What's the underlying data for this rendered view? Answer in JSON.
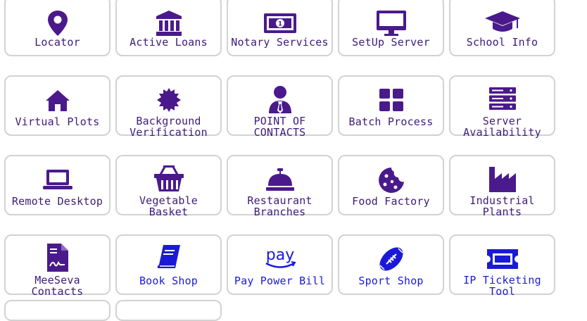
{
  "colors": {
    "accent": "#4a1a8c",
    "label": "#3d1b7a",
    "border": "#d2d2d2",
    "blue": "#1a1ad6"
  },
  "tiles": [
    {
      "label": "Locator",
      "icon": "map-pin-icon"
    },
    {
      "label": "Active Loans",
      "icon": "bank-icon"
    },
    {
      "label": "Notary Services",
      "icon": "money-bill-icon"
    },
    {
      "label": "SetUp Server",
      "icon": "desktop-icon"
    },
    {
      "label": "School Info",
      "icon": "graduation-cap-icon"
    },
    {
      "label": "Virtual Plots",
      "icon": "home-icon"
    },
    {
      "label": "Background Verification",
      "icon": "certificate-icon"
    },
    {
      "label": "POINT OF CONTACTS",
      "icon": "user-tie-icon"
    },
    {
      "label": "Batch Process",
      "icon": "grid-icon"
    },
    {
      "label": "Server Availability",
      "icon": "server-icon"
    },
    {
      "label": "Remote Desktop",
      "icon": "laptop-icon"
    },
    {
      "label": "Vegetable Basket",
      "icon": "basket-icon"
    },
    {
      "label": "Restaurant Branches",
      "icon": "concierge-bell-icon"
    },
    {
      "label": "Food Factory",
      "icon": "cookie-icon"
    },
    {
      "label": "Industrial Plants",
      "icon": "industry-icon"
    },
    {
      "label": "MeeSeva Contacts",
      "icon": "file-signature-icon"
    },
    {
      "label": "Book Shop",
      "icon": "book-icon"
    },
    {
      "label": "Pay Power Bill",
      "icon": "amazon-pay-icon"
    },
    {
      "label": "Sport Shop",
      "icon": "football-icon"
    },
    {
      "label": "IP Ticketing Tool",
      "icon": "ticket-icon"
    }
  ],
  "amazon_pay_text": "pay"
}
